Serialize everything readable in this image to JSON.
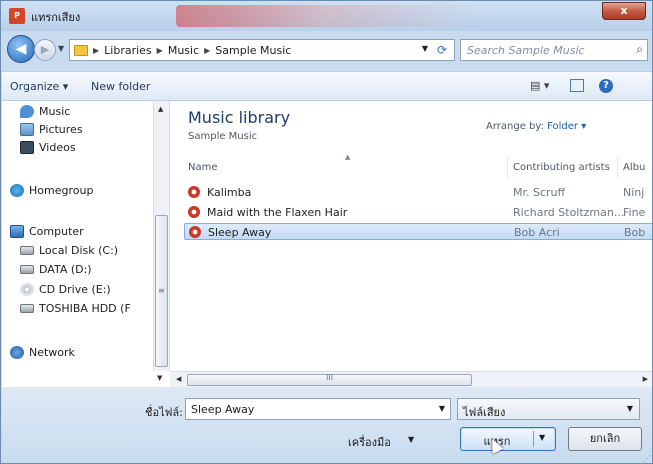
{
  "window": {
    "title": "แทรกเสียง",
    "app_icon_text": "P",
    "close_label": "x"
  },
  "navigation": {
    "back_glyph": "◀",
    "forward_glyph": "▶",
    "breadcrumb": [
      "Libraries",
      "Music",
      "Sample Music"
    ],
    "search_placeholder": "Search Sample Music"
  },
  "toolbar": {
    "organize_label": "Organize ▾",
    "new_folder_label": "New folder",
    "views_glyph": "▤ ▾",
    "help_glyph": "?"
  },
  "nav_pane": {
    "items": [
      {
        "label": "Music",
        "icon": "music-icon"
      },
      {
        "label": "Pictures",
        "icon": "pictures-icon"
      },
      {
        "label": "Videos",
        "icon": "videos-icon"
      },
      {
        "label": "Homegroup",
        "icon": "homegroup-icon"
      },
      {
        "label": "Computer",
        "icon": "computer-icon"
      },
      {
        "label": "Local Disk (C:)",
        "icon": "local-disk-icon"
      },
      {
        "label": "DATA (D:)",
        "icon": "drive-icon"
      },
      {
        "label": "CD Drive (E:)",
        "icon": "cd-drive-icon"
      },
      {
        "label": "TOSHIBA HDD (F",
        "icon": "drive-icon"
      },
      {
        "label": "Network",
        "icon": "network-icon"
      }
    ]
  },
  "library": {
    "title": "Music library",
    "subtitle": "Sample Music",
    "arrange_label": "Arrange by:",
    "arrange_value": "Folder ▾"
  },
  "table": {
    "columns": [
      "Name",
      "Contributing artists",
      "Albu"
    ],
    "rows": [
      {
        "name": "Kalimba",
        "artist": "Mr. Scruff",
        "album": "Ninj",
        "selected": false
      },
      {
        "name": "Maid with the Flaxen Hair",
        "artist": "Richard Stoltzman...",
        "album": "Fine",
        "selected": false
      },
      {
        "name": "Sleep Away",
        "artist": "Bob Acri",
        "album": "Bob",
        "selected": true
      }
    ]
  },
  "scrollbar": {
    "grip_glyph": "III"
  },
  "footer": {
    "filename_label": "ชื่อไฟล์:",
    "filename_value": "Sleep Away",
    "filetype_value": "ไฟล์เสียง",
    "tools_label": "เครื่องมือ",
    "insert_label": "แทรก",
    "cancel_label": "ยกเลิก"
  }
}
